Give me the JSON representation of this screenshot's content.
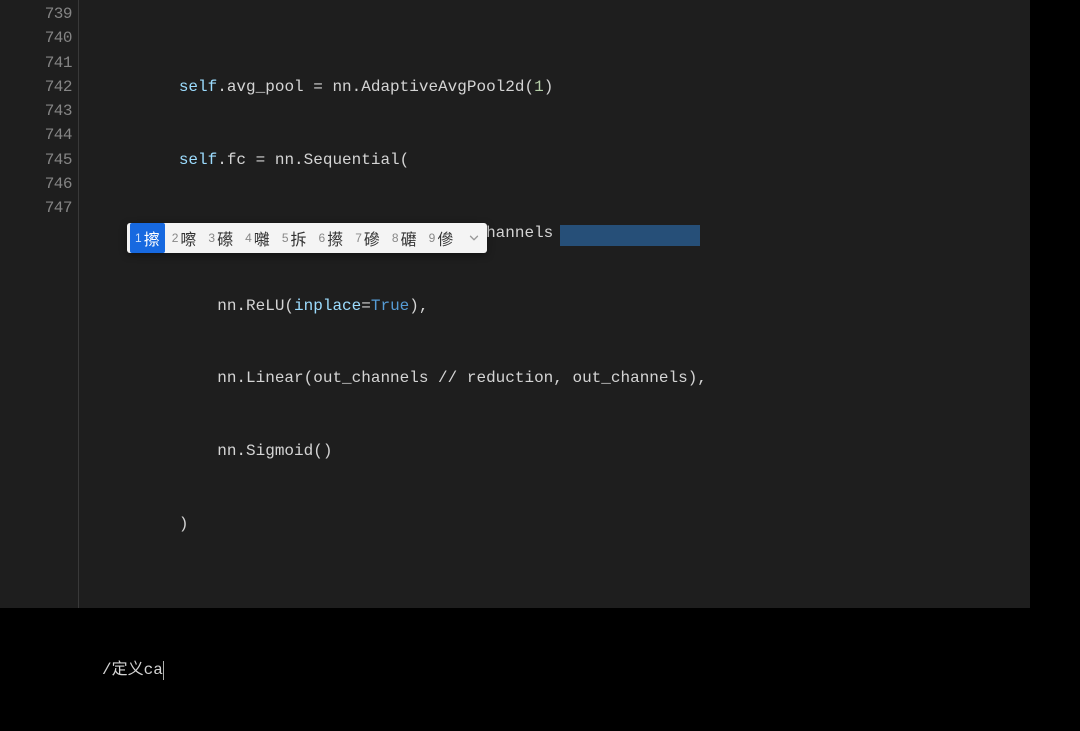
{
  "gutter": {
    "start": 739,
    "lines": [
      "739",
      "740",
      "741",
      "742",
      "743",
      "744",
      "745",
      "746",
      "747"
    ]
  },
  "code": {
    "l739": {
      "indent": "        ",
      "self": "self",
      "dot": ".",
      "prop": "avg_pool = nn.AdaptiveAvgPool2d(",
      "num": "1",
      "close": ")"
    },
    "l740": {
      "indent": "        ",
      "self": "self",
      "dot": ".",
      "prop": "fc = nn.Sequential("
    },
    "l741": {
      "indent": "            ",
      "text": "nn.Linear(in_channels, out_channels // reduction),"
    },
    "l742": {
      "indent": "            ",
      "pre": "nn.ReLU(",
      "param": "inplace",
      "eq": "=",
      "val": "True",
      "post": "),"
    },
    "l743": {
      "indent": "            ",
      "text": "nn.Linear(out_channels // reduction, out_channels),"
    },
    "l744": {
      "indent": "            ",
      "text": "nn.Sigmoid()"
    },
    "l745": {
      "indent": "        ",
      "text": ")"
    },
    "l746": {
      "text": ""
    },
    "l747": {
      "text": "/定义ca"
    }
  },
  "ime": {
    "candidates": [
      {
        "n": "1",
        "c": "擦"
      },
      {
        "n": "2",
        "c": "嚓"
      },
      {
        "n": "3",
        "c": "礤"
      },
      {
        "n": "4",
        "c": "囃"
      },
      {
        "n": "5",
        "c": "拆"
      },
      {
        "n": "6",
        "c": "攃"
      },
      {
        "n": "7",
        "c": "磣"
      },
      {
        "n": "8",
        "c": "礳"
      },
      {
        "n": "9",
        "c": "傪"
      }
    ]
  }
}
